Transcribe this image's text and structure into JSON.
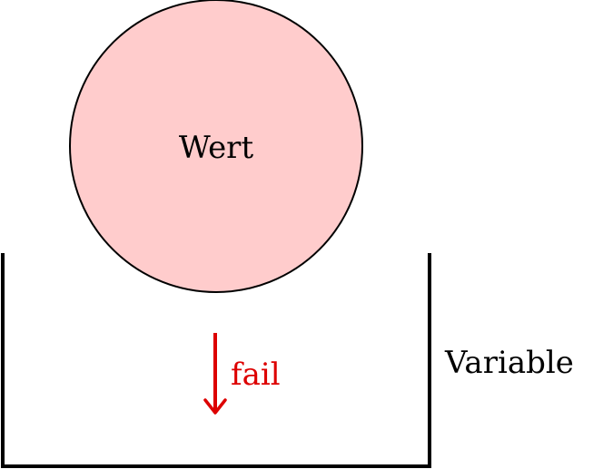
{
  "diagram": {
    "value_label": "Wert",
    "variable_label": "Variable",
    "fail_label": "fail",
    "colors": {
      "circle_fill": "#ffcccc",
      "stroke": "#000000",
      "fail": "#dd0000"
    }
  }
}
